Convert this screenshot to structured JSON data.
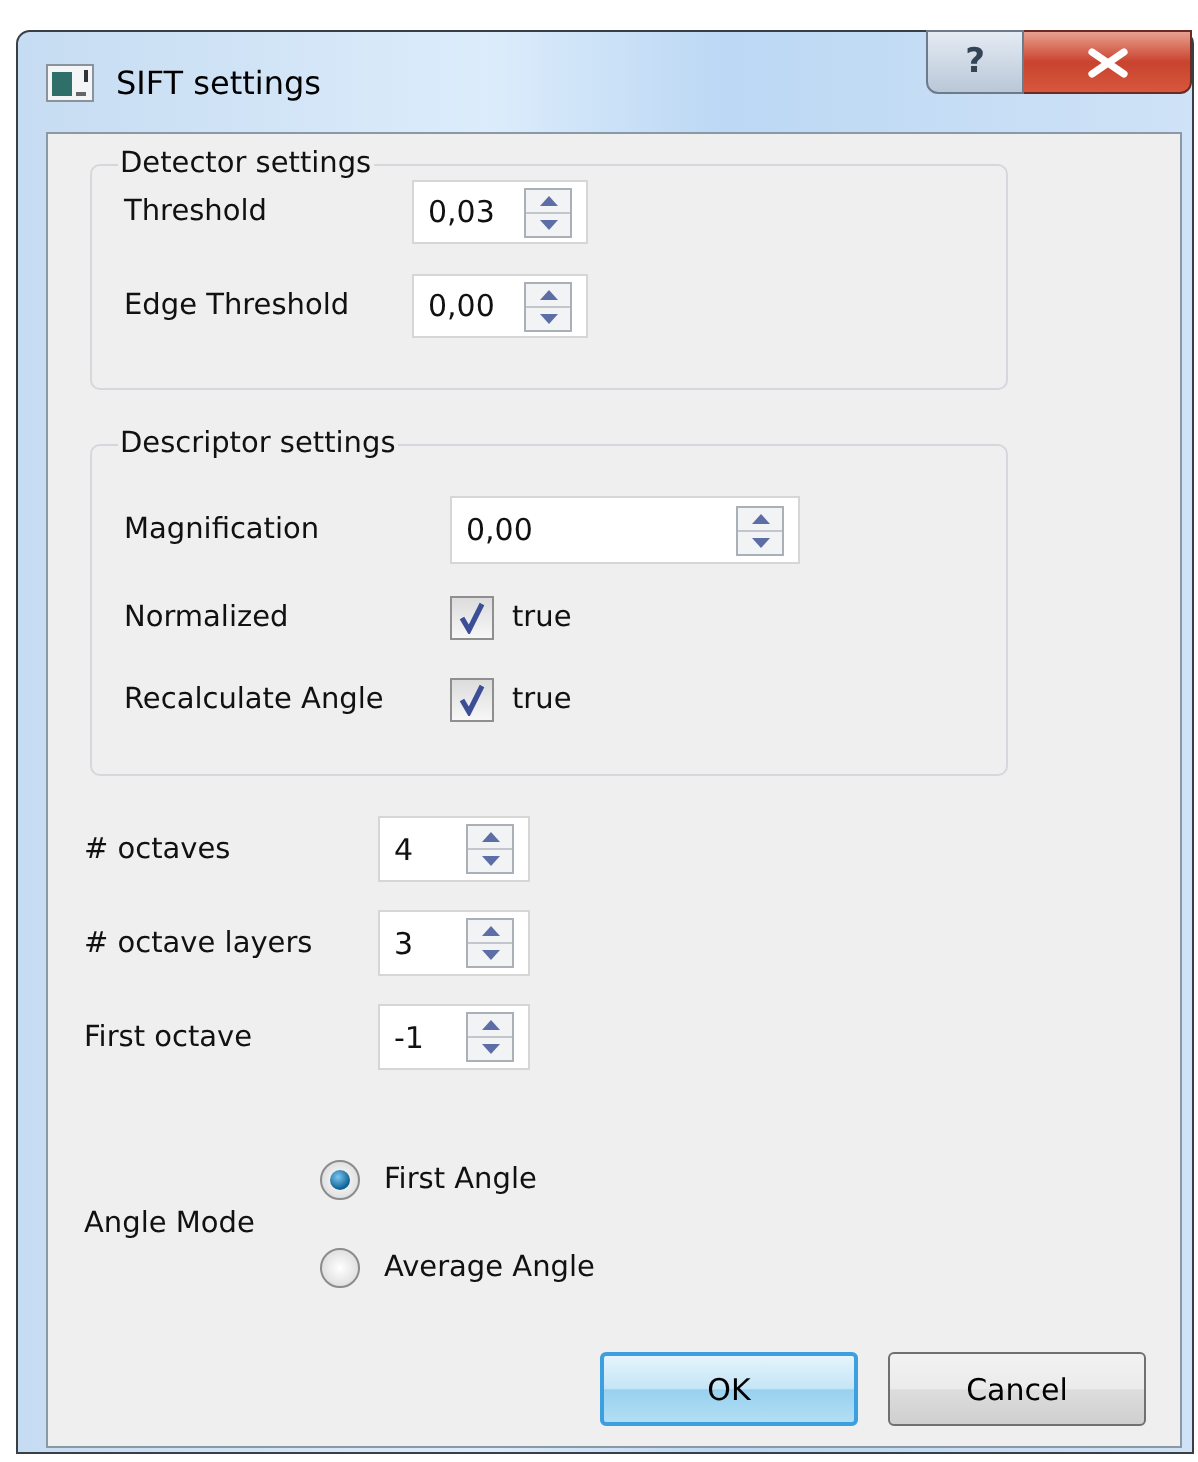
{
  "window": {
    "title": "SIFT settings",
    "help": "?"
  },
  "detector_settings": {
    "title": "Detector settings",
    "fields": [
      {
        "kind": "spin",
        "label": "Threshold",
        "value": "0,03"
      },
      {
        "kind": "spin",
        "label": "Edge Threshold",
        "value": "0,00"
      }
    ]
  },
  "descriptor_settings": {
    "title": "Descriptor settings",
    "fields": [
      {
        "kind": "spin",
        "label": "Magnification",
        "value": "0,00"
      },
      {
        "kind": "check",
        "label": "Normalized",
        "checked": true,
        "text": "true"
      },
      {
        "kind": "check",
        "label": "Recalculate Angle",
        "checked": true,
        "text": "true"
      }
    ]
  },
  "fields": [
    {
      "kind": "spin",
      "label": "# octaves",
      "value": "4"
    },
    {
      "kind": "spin",
      "label": "# octave layers",
      "value": "3"
    },
    {
      "kind": "spin",
      "label": "First octave",
      "value": "-1"
    }
  ],
  "angle_mode": {
    "label": "Angle Mode",
    "options": [
      {
        "label": "First Angle",
        "selected": true
      },
      {
        "label": "Average Angle",
        "selected": false
      }
    ]
  },
  "buttons": [
    {
      "label": "OK",
      "default": true
    },
    {
      "label": "Cancel",
      "default": false
    }
  ]
}
